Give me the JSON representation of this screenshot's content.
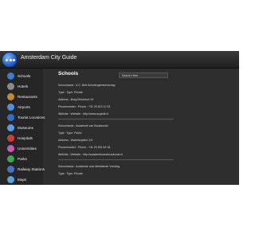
{
  "app": {
    "title": "Amsterdam City Guide"
  },
  "sidebar": {
    "items": [
      {
        "label": "Schools",
        "icon": "schools-icon",
        "color": "#3b7bd6"
      },
      {
        "label": "Hotels",
        "icon": "hotels-icon",
        "color": "#8a8a8a"
      },
      {
        "label": "Restaurants",
        "icon": "restaurants-icon",
        "color": "#c98a2b"
      },
      {
        "label": "Airports",
        "icon": "airports-icon",
        "color": "#4f8fe0"
      },
      {
        "label": "Tourist Locations",
        "icon": "tourist-locations-icon",
        "color": "#2f6fcf"
      },
      {
        "label": "Museums",
        "icon": "museums-icon",
        "color": "#5e9ae6"
      },
      {
        "label": "Hospitals",
        "icon": "hospitals-icon",
        "color": "#d63b3b"
      },
      {
        "label": "Universities",
        "icon": "universities-icon",
        "color": "#c95ab8"
      },
      {
        "label": "Parks",
        "icon": "parks-icon",
        "color": "#3fa74b"
      },
      {
        "label": "Railway Stations",
        "icon": "railway-stations-icon",
        "color": "#4a6fd0"
      },
      {
        "label": "Maps",
        "icon": "maps-icon",
        "color": "#5aa1e3"
      }
    ]
  },
  "main": {
    "title": "Schools",
    "search": {
      "placeholder": "Search Here"
    },
    "entries": [
      {
        "lines": [
          "Schoolname : A.C. Bolt Scholengemeenschap",
          "Type : Type: Private",
          "Address : Burg.Elsschout 19",
          "Phonenumber : Phone : +31 20 613 10 33",
          "Website : Website : http://www.acgbolt.nl"
        ]
      },
      {
        "lines": [
          "Schoolname : Academie van Bouwkunst",
          "Type : Type: Public",
          "Address : Waterlooplein 211",
          "Phonenumber : Phone : +31 20 531 82 18",
          "Website : Website : http://academievanbouwkunst.nl"
        ]
      },
      {
        "lines": [
          "Schoolname : Academie voor Beeldende Vorming",
          "Type : Type: Private"
        ]
      }
    ]
  }
}
